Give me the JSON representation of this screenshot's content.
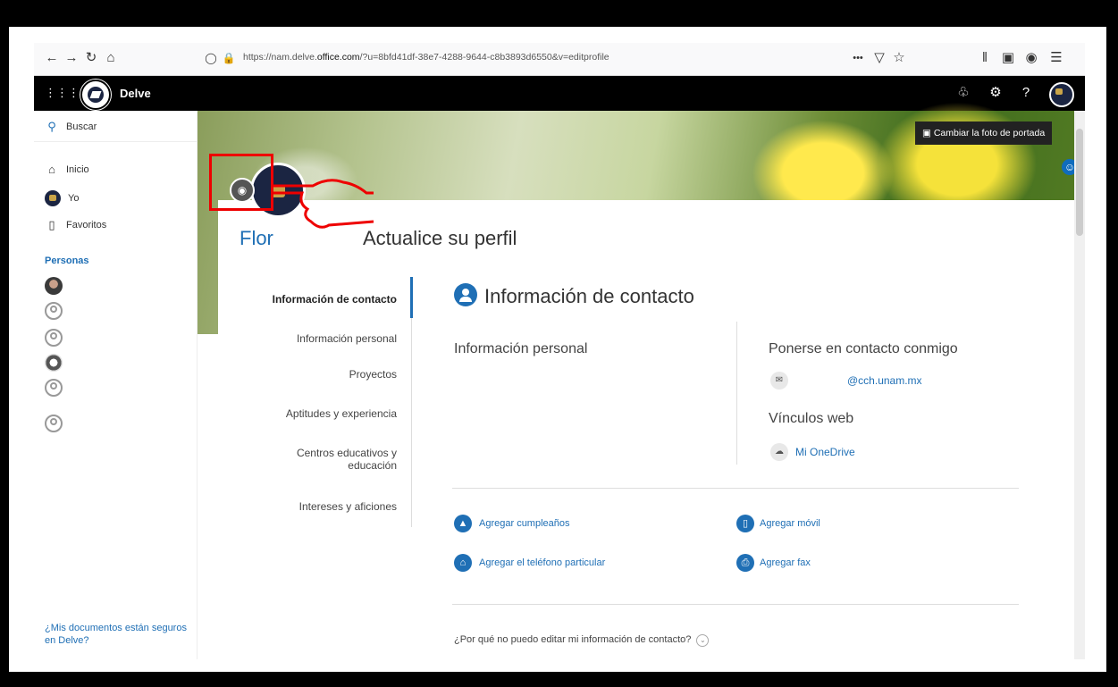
{
  "browser": {
    "url_prefix": "https://nam.delve.",
    "url_domain": "office.com",
    "url_suffix": "/?u=8bfd41df-38e7-4288-9644-c8b3893d6550&v=editprofile",
    "menu_dots": "•••"
  },
  "app": {
    "title": "Delve"
  },
  "sidebar": {
    "search_label": "Buscar",
    "items": [
      {
        "label": "Inicio",
        "icon": "home-icon"
      },
      {
        "label": "Yo",
        "icon": "user-avatar"
      },
      {
        "label": "Favoritos",
        "icon": "bookmark-icon"
      }
    ],
    "people_header": "Personas",
    "footer_question": "¿Mis documentos están seguros en Delve?"
  },
  "banner": {
    "change_cover_label": "Cambiar la foto de portada"
  },
  "profile": {
    "name": "Flor",
    "update_label": "Actualice su perfil"
  },
  "nav": {
    "items": [
      "Información de contacto",
      "Información personal",
      "Proyectos",
      "Aptitudes y experiencia",
      "Centros educativos y educación",
      "Intereses y aficiones"
    ],
    "active_index": 0
  },
  "contact": {
    "section_title": "Información de contacto",
    "personal_info_title": "Información personal",
    "contact_me_title": "Ponerse en contacto conmigo",
    "email": "@cch.unam.mx",
    "web_links_title": "Vínculos web",
    "onedrive_label": "Mi OneDrive",
    "add_birthday": "Agregar cumpleaños",
    "add_mobile": "Agregar móvil",
    "add_home_phone": "Agregar el teléfono particular",
    "add_fax": "Agregar fax",
    "why_cant_edit": "¿Por qué no puedo editar mi información de contacto?"
  },
  "colors": {
    "accent": "#1f6fb5",
    "header": "#000000",
    "annotation": "#e00000"
  }
}
